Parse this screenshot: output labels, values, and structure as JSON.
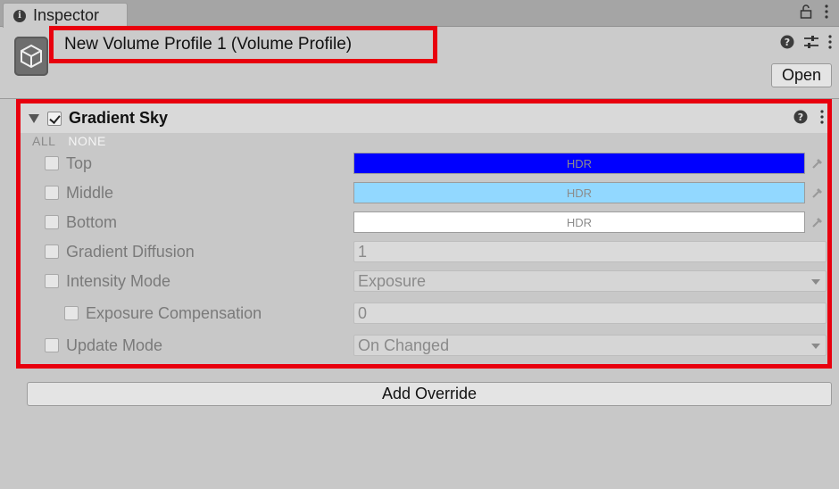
{
  "tab": {
    "label": "Inspector",
    "icon": "info-icon"
  },
  "header": {
    "title": "New Volume Profile 1 (Volume Profile)",
    "open_label": "Open"
  },
  "component": {
    "title": "Gradient Sky",
    "enabled": true,
    "all_label": "ALL",
    "none_label": "NONE",
    "properties": [
      {
        "label": "Top",
        "type": "color",
        "value": "HDR",
        "color": "#0000ff"
      },
      {
        "label": "Middle",
        "type": "color",
        "value": "HDR",
        "color": "#92d8ff"
      },
      {
        "label": "Bottom",
        "type": "color",
        "value": "HDR",
        "color": "#ffffff"
      },
      {
        "label": "Gradient Diffusion",
        "type": "float",
        "value": "1"
      },
      {
        "label": "Intensity Mode",
        "type": "enum",
        "value": "Exposure"
      },
      {
        "label": "Exposure Compensation",
        "type": "float",
        "value": "0",
        "indent": true
      },
      {
        "label": "Update Mode",
        "type": "enum",
        "value": "On Changed"
      }
    ]
  },
  "add_override_label": "Add Override",
  "colors": {
    "highlight": "#e8000e",
    "background": "#c8c8c8"
  }
}
